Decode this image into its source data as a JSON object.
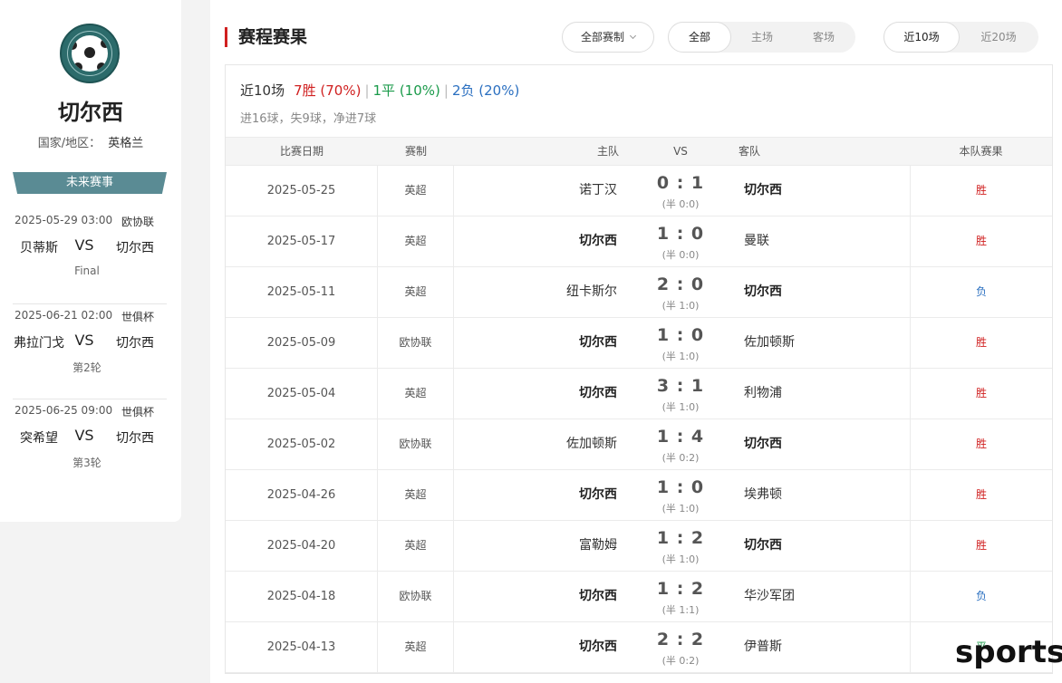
{
  "team": {
    "name": "切尔西",
    "country_label": "国家/地区：",
    "country": "英格兰"
  },
  "future": {
    "title": "未来赛事",
    "matches": [
      {
        "date": "2025-05-29 03:00",
        "comp": "欧协联",
        "home": "贝蒂斯",
        "vs": "VS",
        "away": "切尔西",
        "round": "Final"
      },
      {
        "date": "2025-06-21 02:00",
        "comp": "世俱杯",
        "home": "弗拉门戈",
        "vs": "VS",
        "away": "切尔西",
        "round": "第2轮"
      },
      {
        "date": "2025-06-25 09:00",
        "comp": "世俱杯",
        "home": "突希望",
        "vs": "VS",
        "away": "切尔西",
        "round": "第3轮"
      }
    ]
  },
  "main": {
    "title": "赛程赛果",
    "dropdown": "全部赛制",
    "venue_tabs": [
      "全部",
      "主场",
      "客场"
    ],
    "range_tabs": [
      "近10场",
      "近20场"
    ],
    "summary": {
      "label": "近10场",
      "wins": "7胜 (70%)",
      "draws": "1平 (10%)",
      "losses": "2负 (20%)",
      "goals": "进16球，失9球，净进7球"
    },
    "headers": {
      "date": "比赛日期",
      "comp": "赛制",
      "home": "主队",
      "vs": "VS",
      "away": "客队",
      "result": "本队赛果"
    },
    "rows": [
      {
        "date": "2025-05-25",
        "comp": "英超",
        "home": "诺丁汉",
        "score": "0 : 1",
        "half": "(半 0:0)",
        "away": "切尔西",
        "result": "胜"
      },
      {
        "date": "2025-05-17",
        "comp": "英超",
        "home": "切尔西",
        "score": "1 : 0",
        "half": "(半 0:0)",
        "away": "曼联",
        "result": "胜"
      },
      {
        "date": "2025-05-11",
        "comp": "英超",
        "home": "纽卡斯尔",
        "score": "2 : 0",
        "half": "(半 1:0)",
        "away": "切尔西",
        "result": "负"
      },
      {
        "date": "2025-05-09",
        "comp": "欧协联",
        "home": "切尔西",
        "score": "1 : 0",
        "half": "(半 1:0)",
        "away": "佐加顿斯",
        "result": "胜"
      },
      {
        "date": "2025-05-04",
        "comp": "英超",
        "home": "切尔西",
        "score": "3 : 1",
        "half": "(半 1:0)",
        "away": "利物浦",
        "result": "胜"
      },
      {
        "date": "2025-05-02",
        "comp": "欧协联",
        "home": "佐加顿斯",
        "score": "1 : 4",
        "half": "(半 0:2)",
        "away": "切尔西",
        "result": "胜"
      },
      {
        "date": "2025-04-26",
        "comp": "英超",
        "home": "切尔西",
        "score": "1 : 0",
        "half": "(半 1:0)",
        "away": "埃弗顿",
        "result": "胜"
      },
      {
        "date": "2025-04-20",
        "comp": "英超",
        "home": "富勒姆",
        "score": "1 : 2",
        "half": "(半 1:0)",
        "away": "切尔西",
        "result": "胜"
      },
      {
        "date": "2025-04-18",
        "comp": "欧协联",
        "home": "切尔西",
        "score": "1 : 2",
        "half": "(半 1:1)",
        "away": "华沙军团",
        "result": "负"
      },
      {
        "date": "2025-04-13",
        "comp": "英超",
        "home": "切尔西",
        "score": "2 : 2",
        "half": "(半 0:2)",
        "away": "伊普斯",
        "result": "平"
      }
    ]
  },
  "watermark": "sports"
}
